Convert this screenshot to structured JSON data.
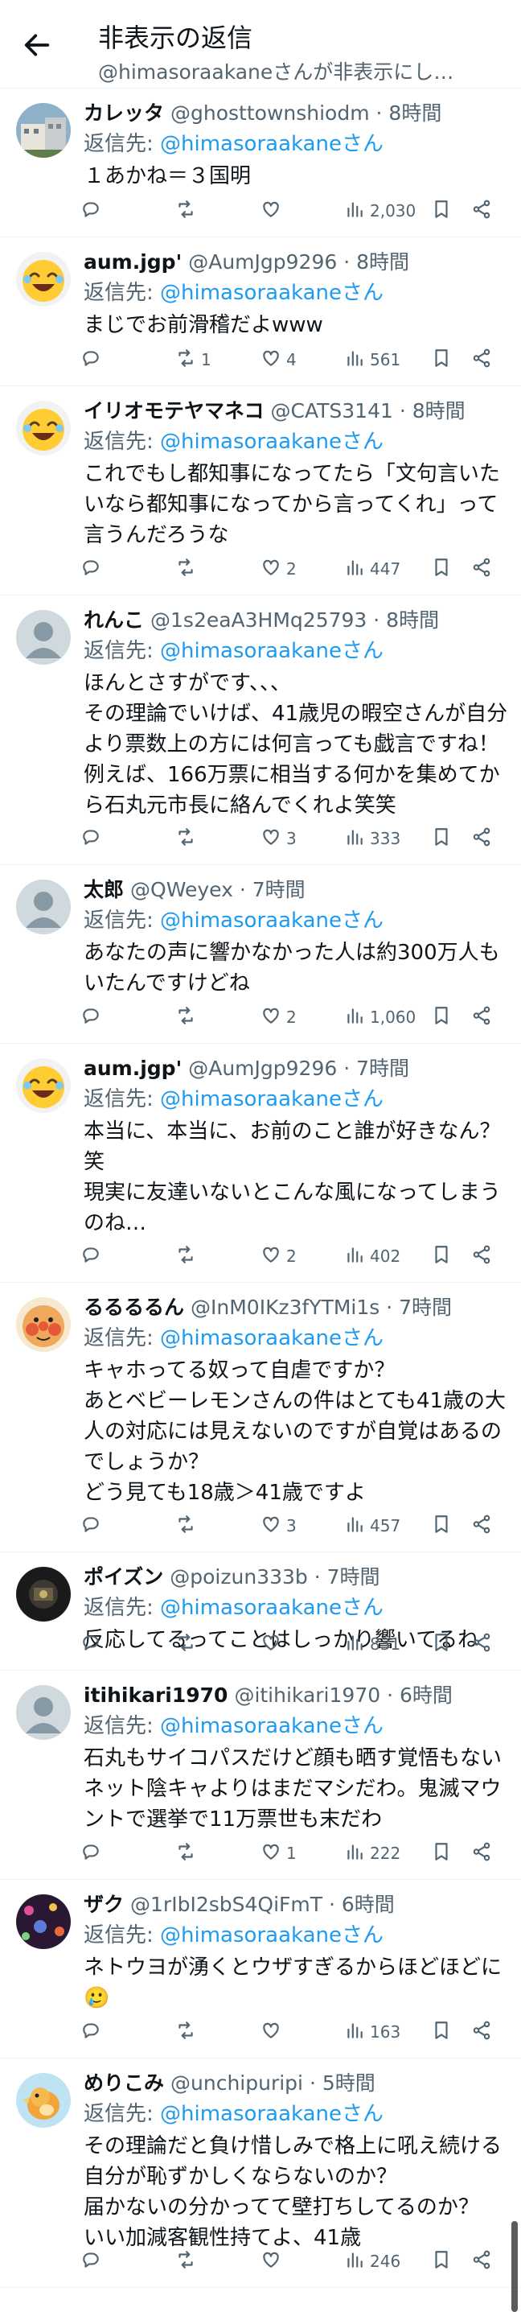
{
  "header": {
    "title": "非表示の返信",
    "subtitle": "@himasoraakaneさんが非表示にし…"
  },
  "reply_prefix": "返信先:",
  "tweets": [
    {
      "name": "カレッタ",
      "handle": "@ghosttownshiodm",
      "time": "· 8時間",
      "mention": "@himasoraakaneさん",
      "text": "１あかね＝３国明",
      "replies": "",
      "retweets": "",
      "likes": "",
      "views": "2,030",
      "avatar": "photo",
      "lines": 1
    },
    {
      "name": "aum.jgp'",
      "handle": "@AumJgp9296",
      "time": "· 8時間",
      "mention": "@himasoraakaneさん",
      "text": "まじでお前滑稽だよwww",
      "replies": "",
      "retweets": "1",
      "likes": "4",
      "views": "561",
      "avatar": "emoji",
      "lines": 1
    },
    {
      "name": "イリオモテヤマネコ",
      "handle": "@CATS3141",
      "time": "· 8時間",
      "mention": "@himasoraakaneさん",
      "text": "これでもし都知事になってたら「文句言いたいなら都知事になってから言ってくれ」って言うんだろうな",
      "replies": "",
      "retweets": "",
      "likes": "2",
      "views": "447",
      "avatar": "emoji",
      "lines": 3
    },
    {
      "name": "れんこ",
      "handle": "@1s2eaA3HMq25793",
      "time": "· 8時間",
      "mention": "@himasoraakaneさん",
      "text": "ほんとさすがです、、、\nその理論でいけば、41歳児の暇空さんが自分より票数上の方には何言っても戯言ですね！例えば、166万票に相当する何かを集めてから石丸元市長に絡んでくれよ笑笑",
      "replies": "",
      "retweets": "",
      "likes": "3",
      "views": "333",
      "avatar": "default",
      "lines": 5
    },
    {
      "name": "太郎",
      "handle": "@QWeyex",
      "time": "· 7時間",
      "mention": "@himasoraakaneさん",
      "text": "あなたの声に響かなかった人は約300万人もいたんですけどね",
      "replies": "",
      "retweets": "",
      "likes": "2",
      "views": "1,060",
      "avatar": "default",
      "lines": 2
    },
    {
      "name": "aum.jgp'",
      "handle": "@AumJgp9296",
      "time": "· 7時間",
      "mention": "@himasoraakaneさん",
      "text": "本当に、本当に、お前のこと誰が好きなん？笑\n現実に友達いないとこんな風になってしまうのね…",
      "replies": "",
      "retweets": "",
      "likes": "2",
      "views": "402",
      "avatar": "emoji",
      "lines": 4
    },
    {
      "name": "るるるるん",
      "handle": "@InM0IKz3fYTMi1s",
      "time": "· 7時間",
      "mention": "@himasoraakaneさん",
      "text": "キャホってる奴って自虐ですか？\nあとベビーレモンさんの件はとても41歳の大人の対応には見えないのですが自覚はあるのでしょうか？\nどう見ても18歳＞41歳ですよ",
      "replies": "",
      "retweets": "",
      "likes": "3",
      "views": "457",
      "avatar": "anpan",
      "lines": 5
    },
    {
      "name": "ポイズン",
      "handle": "@poizun333b",
      "time": "· 7時間",
      "mention": "@himasoraakaneさん",
      "text": "反応してるってことはしっかり響いてるね",
      "replies": "",
      "retweets": "",
      "likes": "",
      "views": "831",
      "avatar": "dark",
      "lines": 1
    },
    {
      "name": "itihikari1970",
      "handle": "@itihikari1970",
      "time": "· 6時間",
      "mention": "@himasoraakaneさん",
      "text": "石丸もサイコパスだけど顔も晒す覚悟もないネット陰キャよりはまだマシだわ。鬼滅マウントで選挙で11万票世も末だわ",
      "replies": "",
      "retweets": "",
      "likes": "1",
      "views": "222",
      "avatar": "default",
      "lines": 3
    },
    {
      "name": "ザク",
      "handle": "@1rIbI2sbS4QiFmT",
      "time": "· 6時間",
      "mention": "@himasoraakaneさん",
      "text": "ネトウヨが湧くとウザすぎるからほどほどに\n🥲",
      "replies": "",
      "retweets": "",
      "likes": "",
      "views": "163",
      "avatar": "night",
      "lines": 2
    },
    {
      "name": "めりこみ",
      "handle": "@unchipuripi",
      "time": "· 5時間",
      "mention": "@himasoraakaneさん",
      "text": "その理論だと負け惜しみで格上に吼え続ける自分が恥ずかしくならないのか？\n届かないの分かってて壁打ちしてるのか？\nいい加減客観性持てよ、41歳",
      "replies": "",
      "retweets": "",
      "likes": "",
      "views": "246",
      "avatar": "bird",
      "lines": 4
    }
  ],
  "icons": {
    "back": "back-arrow-icon",
    "reply": "reply-icon",
    "retweet": "retweet-icon",
    "like": "heart-icon",
    "views": "views-icon",
    "bookmark": "bookmark-icon",
    "share": "share-icon"
  },
  "colors": {
    "link": "#1d9bf0",
    "muted": "#536471",
    "text": "#0f1419",
    "divider": "#eff3f4"
  }
}
